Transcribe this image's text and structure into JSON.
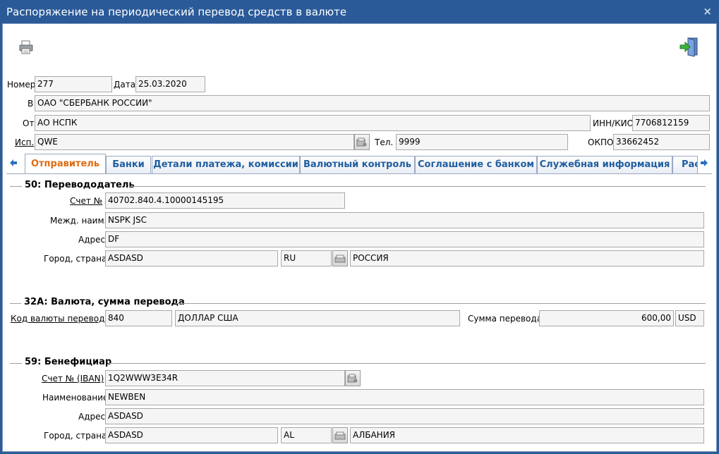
{
  "window": {
    "title": "Распоряжение на периодический перевод средств в валюте",
    "close_glyph": "×"
  },
  "toolbar": {
    "print_icon": "printer-icon",
    "exit_icon": "exit-door-icon"
  },
  "header": {
    "number_label": "Номер",
    "number_value": "277",
    "date_label": "Дата",
    "date_value": "25.03.2020",
    "to_label": "В",
    "to_value": "ОАО \"СБЕРБАНК РОССИИ\"",
    "from_label": "От",
    "from_value": "АО НСПК",
    "inn_label": "ИНН/КИО",
    "inn_value": "7706812159",
    "executor_label": "Исп.",
    "executor_value": "QWE",
    "phone_label": "Тел.",
    "phone_value": "9999",
    "okpo_label": "ОКПО",
    "okpo_value": "33662452"
  },
  "tabs": [
    {
      "label": "Отправитель",
      "active": true
    },
    {
      "label": "Банки",
      "active": false
    },
    {
      "label": "Детали платежа, комиссии",
      "active": false
    },
    {
      "label": "Валютный контроль",
      "active": false
    },
    {
      "label": "Соглашение с банком",
      "active": false
    },
    {
      "label": "Служебная информация",
      "active": false
    },
    {
      "label": "Рас",
      "active": false
    }
  ],
  "sender": {
    "title": "50: Перевододатель",
    "account_label": "Счет №",
    "account_value": "40702.840.4.10000145195",
    "intl_name_label": "Межд. наим.",
    "intl_name_value": "NSPK JSC",
    "address_label": "Адрес",
    "address_value": "DF",
    "city_label": "Город, страна",
    "city_value": "ASDASD",
    "country_code": "RU",
    "country_name": "РОССИЯ"
  },
  "amount": {
    "title": "32A: Валюта, сумма перевода",
    "currency_code_label": "Код валюты перевода",
    "currency_code": "840",
    "currency_name": "ДОЛЛАР США",
    "sum_label": "Сумма перевода",
    "sum_value": "600,00",
    "sum_currency": "USD"
  },
  "beneficiary": {
    "title": "59: Бенефициар",
    "account_label": "Счет № (IBAN)",
    "account_value": "1Q2WWW3E34R",
    "name_label": "Наименование",
    "name_value": "NEWBEN",
    "address_label": "Адрес",
    "address_value": "ASDASD",
    "city_label": "Город, страна",
    "city_value": "ASDASD",
    "country_code": "AL",
    "country_name": "АЛБАНИЯ"
  },
  "colors": {
    "titlebar": "#2a5a98",
    "tab_active": "#e06a12",
    "tab_text": "#1f5ea0"
  }
}
